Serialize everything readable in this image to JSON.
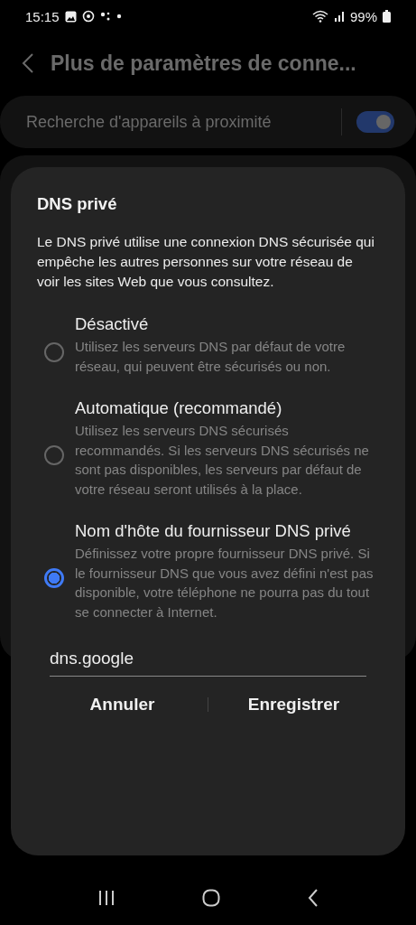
{
  "status_bar": {
    "time": "15:15",
    "battery": "99%"
  },
  "header": {
    "title": "Plus de paramètres de conne..."
  },
  "background_settings": [
    {
      "label": "Recherche d'appareils à proximité",
      "on": true
    }
  ],
  "dialog": {
    "title": "DNS privé",
    "description": "Le DNS privé utilise une connexion DNS sécurisée qui empêche les autres personnes sur votre réseau de voir les sites Web que vous consultez.",
    "options": [
      {
        "title": "Désactivé",
        "description": "Utilisez les serveurs DNS par défaut de votre réseau, qui peuvent être sécurisés ou non.",
        "selected": false
      },
      {
        "title": "Automatique (recommandé)",
        "description": "Utilisez les serveurs DNS sécurisés recommandés. Si les serveurs DNS sécurisés ne sont pas disponibles, les serveurs par défaut de votre réseau seront utilisés à la place.",
        "selected": false
      },
      {
        "title": "Nom d'hôte du fournisseur DNS privé",
        "description": "Définissez votre propre fournisseur DNS privé. Si le fournisseur DNS que vous avez défini n'est pas disponible, votre téléphone ne pourra pas du tout se connecter à Internet.",
        "selected": true
      }
    ],
    "hostname": "dns.google",
    "buttons": [
      "Annuler",
      "Enregistrer"
    ]
  }
}
